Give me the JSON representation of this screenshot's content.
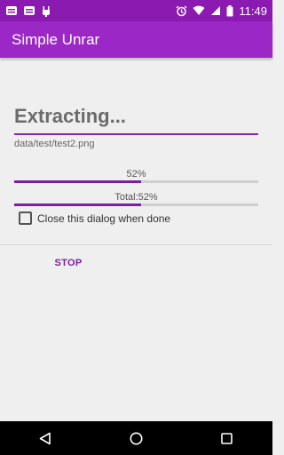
{
  "status_bar": {
    "time": "11:49",
    "left_icons": [
      "notification-icon",
      "notification-icon-2",
      "android-debug-icon"
    ],
    "right_icons": [
      "alarm-icon",
      "wifi-icon",
      "signal-icon",
      "battery-icon"
    ]
  },
  "app_bar": {
    "title": "Simple Unrar",
    "color": "#9b27c6"
  },
  "dialog": {
    "title": "Extracting...",
    "file_path": "data/test/test2.png",
    "file_progress": {
      "label": "52%",
      "value": 0.52
    },
    "total_progress": {
      "label": "Total:52%",
      "value": 0.52
    },
    "close_when_done": {
      "label": "Close this dialog when done",
      "checked": false
    },
    "stop_button_label": "STOP"
  },
  "nav_bar": {
    "buttons": [
      "back-icon",
      "home-icon",
      "recents-icon"
    ]
  }
}
